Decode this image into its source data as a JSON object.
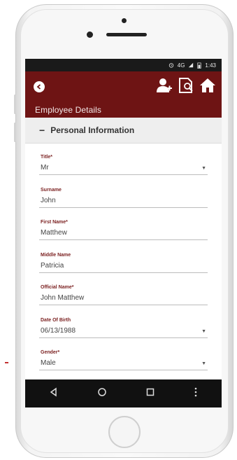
{
  "status_bar": {
    "network": "4G",
    "time": "1:43"
  },
  "app_bar": {
    "title": "Employee Details"
  },
  "icons": {
    "back": "arrow-left-icon",
    "add_user": "add-user-icon",
    "edit_document": "edit-document-icon",
    "home": "home-icon"
  },
  "section": {
    "toggle": "−",
    "title": "Personal Information"
  },
  "fields": [
    {
      "label": "Title*",
      "value": "Mr",
      "dropdown": true
    },
    {
      "label": "Surname",
      "value": "John",
      "dropdown": false
    },
    {
      "label": "First Name*",
      "value": "Matthew",
      "dropdown": false
    },
    {
      "label": "Middle Name",
      "value": "Patricia",
      "dropdown": false
    },
    {
      "label": "Official Name*",
      "value": "John Matthew",
      "dropdown": false
    },
    {
      "label": "Date Of Birth",
      "value": "06/13/1988",
      "dropdown": true
    },
    {
      "label": "Gender*",
      "value": "Male",
      "dropdown": true
    }
  ],
  "nav": {
    "back": "triangle-back-icon",
    "home": "circle-home-icon",
    "recents": "square-recents-icon",
    "more": "vertical-dots-icon"
  },
  "colors": {
    "app_bar": "#6e1414",
    "label": "#7a1f1f",
    "status_bar": "#1a1a1a"
  }
}
